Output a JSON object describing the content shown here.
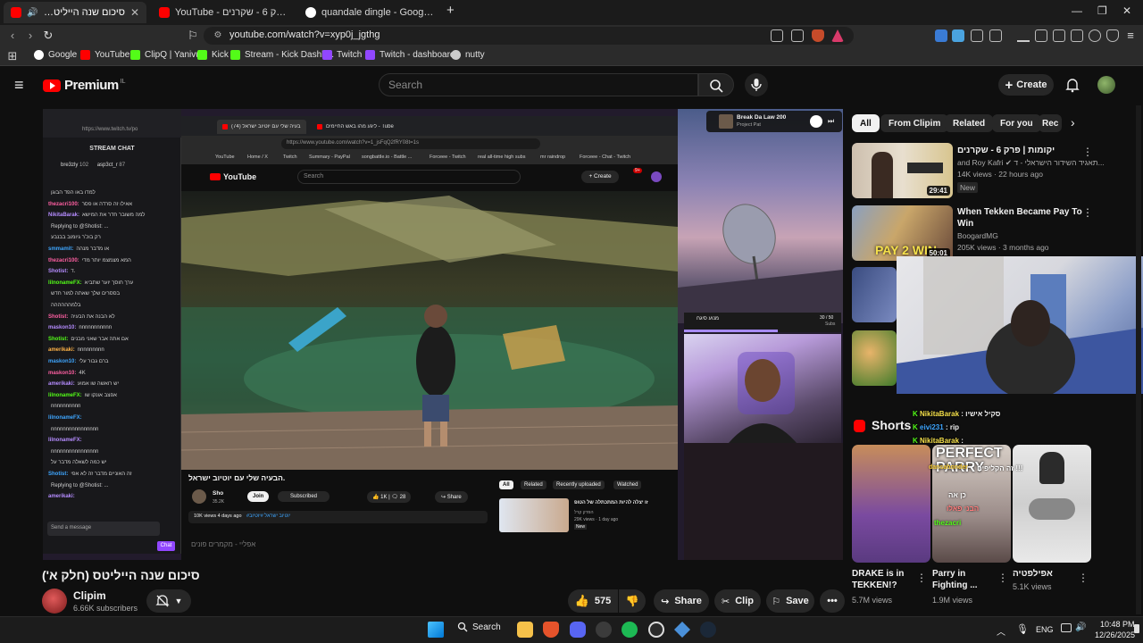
{
  "browser": {
    "tabs": [
      {
        "title": "סיכום שנה הייליטס (חלק א')"
      },
      {
        "title": "YouTube - יקומות | פרק 6 - שקרנים"
      },
      {
        "title": "quandale dingle - Google Search"
      }
    ],
    "url": "youtube.com/watch?v=xyp0j_jgthg",
    "bookmarks": [
      "Google",
      "YouTube",
      "ClipQ | Yanivu",
      "Kick",
      "Stream - Kick Dashb...",
      "Twitch",
      "Twitch - dashboard",
      "nutty"
    ]
  },
  "youtube": {
    "logo_text": "Premium",
    "logo_region": "IL",
    "search_placeholder": "Search",
    "create_label": "Create"
  },
  "player_content": {
    "twitch": {
      "url": "https://www.twitch.tv/po",
      "header": "STREAM CHAT",
      "top_users": [
        {
          "name": "bre3zly",
          "count": "102"
        },
        {
          "name": "asp3ct_r",
          "count": "87"
        }
      ],
      "messages": [
        {
          "user": "",
          "text": "למדו באו הפד הבוגן"
        },
        {
          "user": "thezacri100:",
          "text": "אאילו זה סרדה או פסר"
        },
        {
          "user": "NikitaBarak:",
          "text": "למה משובר חדר את המישא"
        },
        {
          "user": "",
          "text": "Replying to @Shotist: ..."
        },
        {
          "user": "",
          "text": "רק בוכ'ר גיומוב בבנבע"
        },
        {
          "user": "smmamit:",
          "text": "או מדבר מנהה"
        },
        {
          "user": "thezacri100:",
          "text": "המא מצמצמ יותר מדי"
        },
        {
          "user": "Shotist:",
          "text": "ד."
        },
        {
          "user": "lilnonameFX:",
          "text": "ערך חוסך יוער שתביא"
        },
        {
          "user": "",
          "text": "בססרים שלך שאתה למור חדש"
        },
        {
          "user": "",
          "text": "בלמהההההה"
        },
        {
          "user": "Shotist:",
          "text": "לא הבנה את הבעיה"
        },
        {
          "user": "maskon10:",
          "text": "nnnnnnnnnnn"
        },
        {
          "user": "Shotist:",
          "text": "אם אתה אבר שאני מבנים"
        },
        {
          "user": "amerikaki:",
          "text": "nnnnnnnnn"
        },
        {
          "user": "maskon10:",
          "text": "ברם גבור עלי"
        },
        {
          "user": "maskon10:",
          "text": "4K"
        },
        {
          "user": "amerikaki:",
          "text": "יש רואשה שו אמוע"
        },
        {
          "user": "lilnonameFX:",
          "text": "אפצב אונקו שו"
        },
        {
          "user": "",
          "text": "nnnnnnnnnn"
        },
        {
          "user": "lilnonameFX:",
          "text": ""
        },
        {
          "user": "",
          "text": "nnnnnnnnnnnnnnnn"
        },
        {
          "user": "lilnonameFX:",
          "text": ""
        },
        {
          "user": "",
          "text": "nnnnnnnnnnnnnnnn"
        },
        {
          "user": "",
          "text": "יש כמה לשאלה מדבר על"
        },
        {
          "user": "Shotist:",
          "text": "זה האוניים מדבר זה לא אפי"
        },
        {
          "user": "",
          "text": "Replying to @Shotist: ..."
        },
        {
          "user": "amerikaki:",
          "text": ""
        }
      ],
      "send_placeholder": "Send a message",
      "chat_button": "Chat"
    },
    "inner_browser": {
      "tab1": "הבעיה שלי עם יוטיוב ישראל (74)",
      "tab2": "ליגע מהו באש החיימים - Tube",
      "url": "https://www.youtube.com/watch?v=1_jsFqQ2fRY08t=1s",
      "bookmarks": [
        "YouTube",
        "Home / X",
        "Twitch",
        "Summary - PayPal",
        "songbattle.io - Battle ...",
        "Forceee - Twitch",
        "real all-time high subs",
        "mr raindrop",
        "Forceee - Chat - Twitch"
      ],
      "search_placeholder": "Search",
      "create_label": "Create",
      "notif_count": "9+",
      "video_title": "הבעיה שלי עם יוטיוב ישראל.",
      "channel": "Sho",
      "channel_subs": "35.2K",
      "join": "Join",
      "subscribed": "Subscribed",
      "likes": "1K",
      "comments": "28",
      "share": "Share",
      "views_line": "10K views  4 days ago",
      "desc": "#יוטיוב ישראל #יוטיוב",
      "chips": [
        "All",
        "Related",
        "Recently uploaded",
        "Watched"
      ],
      "rec_title": "זו יצלה להיות המתכתלה של הטופ",
      "rec_channel": "הפרק קרל",
      "rec_meta": "29K views · 1 day ago",
      "rec_badge": "New"
    },
    "overlay": {
      "music_title": "Break Da Law 200",
      "music_artist": "Project Pat",
      "sub_label": "מנוע סיגח",
      "sub_count": "30 / 50",
      "sub_unit": "Subs"
    },
    "faded_bar_text": "אפליי - מקמרים פונים"
  },
  "video": {
    "title": "סיכום שנה הייליטס (חלק א')",
    "channel": "Clipim",
    "subscribers": "6.66K subscribers",
    "likes": "575",
    "share": "Share",
    "clip": "Clip",
    "save": "Save"
  },
  "sidebar": {
    "chips": [
      "All",
      "From Clipim",
      "Related",
      "For you",
      "Rec"
    ],
    "recs": [
      {
        "title": "יקומות | פרק 6 - שקרנים",
        "channel": "and Roy Kafri",
        "channel_tail": "תאגיד השידור הישראלי - ד...",
        "meta": "14K views · 22 hours ago",
        "badge": "New",
        "duration": "29:41"
      },
      {
        "title": "When Tekken Became Pay To Win",
        "channel": "BoogardMG",
        "meta": "205K views · 3 months ago",
        "overlay": "PAY 2 WIN",
        "duration": "50:01"
      }
    ],
    "shorts_heading": "Shorts",
    "shorts": [
      {
        "title": "DRAKE is in TEKKEN!?",
        "meta": "5.7M views"
      },
      {
        "title": "Parry in Fighting ...",
        "meta": "1.9M views",
        "overlay": "PERFECT PARRY"
      },
      {
        "title": "אפילפטיה",
        "meta": "5.1K views"
      }
    ],
    "overlay_chat": [
      {
        "user": "NikitaBarak",
        "text": "סקיל אישיו"
      },
      {
        "user": "eivi231",
        "text": "rip"
      },
      {
        "user": "NikitaBarak",
        "text": ""
      }
    ],
    "overlay_snippets": [
      "זה הקליפים !!!",
      "dansahonder",
      "כן אה",
      "הבני פאלו",
      "thezacri"
    ]
  },
  "taskbar": {
    "search_label": "Search",
    "lang": "ENG",
    "time": "10:48 PM",
    "date": "12/26/2025"
  },
  "colors": {
    "yt_red": "#ff0000",
    "twitch_purple": "#9147ff",
    "kick_green": "#53fc18",
    "accent_blue": "#3ea6ff"
  }
}
